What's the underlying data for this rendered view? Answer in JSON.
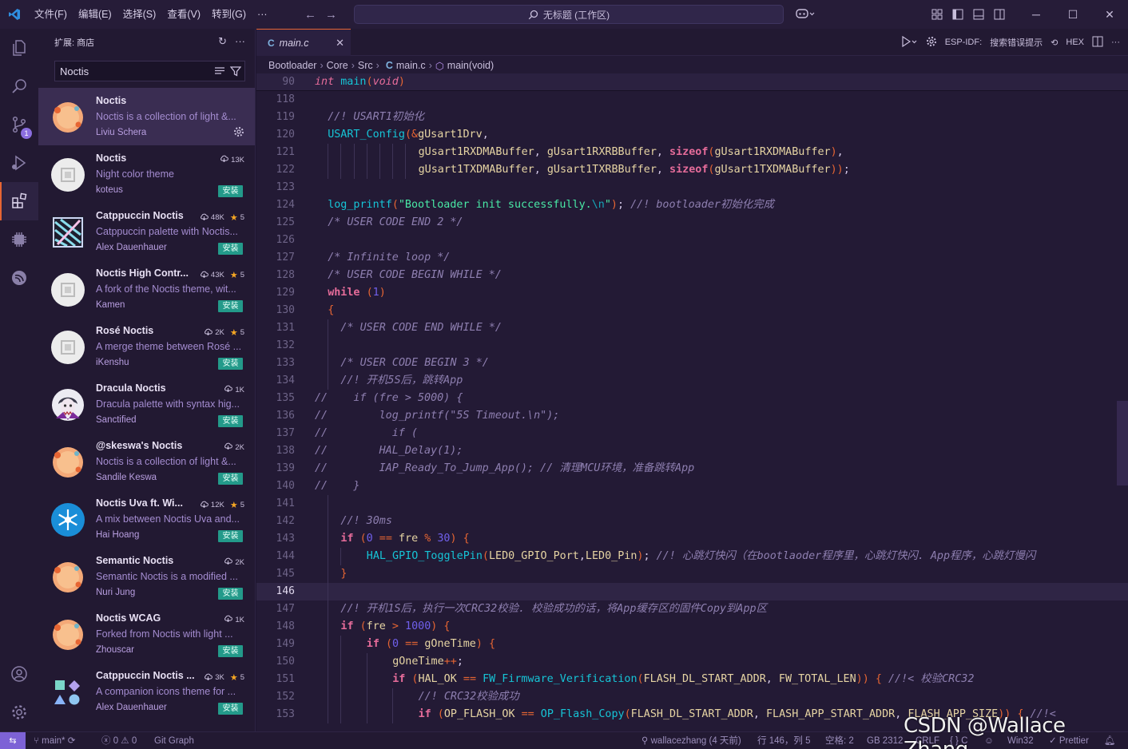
{
  "titlebar": {
    "menus": [
      "文件(F)",
      "编辑(E)",
      "选择(S)",
      "查看(V)",
      "转到(G)",
      "···"
    ],
    "search_text": "无标题 (工作区)"
  },
  "activity": {
    "badge": "1",
    "items": [
      "explorer-icon",
      "search-icon",
      "source-control-icon",
      "run-debug-icon",
      "extensions-icon",
      "chip-icon",
      "espressif-icon"
    ],
    "bottom": [
      "account-icon",
      "settings-gear-icon"
    ]
  },
  "sidebar": {
    "title": "扩展: 商店",
    "search_value": "Noctis",
    "install_label": "安装",
    "extensions": [
      {
        "name": "Noctis",
        "desc": "Noctis is a collection of light &...",
        "publisher": "Liviu Schera",
        "downloads": "",
        "rating": "",
        "installed": true,
        "icon": "noctis-peach"
      },
      {
        "name": "Noctis",
        "desc": "Night color theme",
        "publisher": "koteus",
        "downloads": "13K",
        "rating": "",
        "installed": false,
        "icon": "placeholder"
      },
      {
        "name": "Catppuccin Noctis",
        "desc": "Catppuccin palette with Noctis...",
        "publisher": "Alex Dauenhauer",
        "downloads": "48K",
        "rating": "5",
        "installed": false,
        "icon": "catppuccin"
      },
      {
        "name": "Noctis High Contr...",
        "desc": "A fork of the Noctis theme, wit...",
        "publisher": "Kamen",
        "downloads": "43K",
        "rating": "5",
        "installed": false,
        "icon": "placeholder"
      },
      {
        "name": "Rosé Noctis",
        "desc": "A merge theme between Rosé ...",
        "publisher": "iKenshu",
        "downloads": "2K",
        "rating": "5",
        "installed": false,
        "icon": "placeholder"
      },
      {
        "name": "Dracula Noctis",
        "desc": "Dracula palette with syntax hig...",
        "publisher": "Sanctified",
        "downloads": "1K",
        "rating": "",
        "installed": false,
        "icon": "dracula"
      },
      {
        "name": "@skeswa's Noctis",
        "desc": "Noctis is a collection of light &...",
        "publisher": "Sandile Keswa",
        "downloads": "2K",
        "rating": "",
        "installed": false,
        "icon": "noctis-peach"
      },
      {
        "name": "Noctis Uva ft. Wi...",
        "desc": "A mix between Noctis Uva and...",
        "publisher": "Hai Hoang",
        "downloads": "12K",
        "rating": "5",
        "installed": false,
        "icon": "snowflake"
      },
      {
        "name": "Semantic Noctis",
        "desc": "Semantic Noctis is a modified ...",
        "publisher": "Nuri Jung",
        "downloads": "2K",
        "rating": "",
        "installed": false,
        "icon": "noctis-peach"
      },
      {
        "name": "Noctis WCAG",
        "desc": "Forked from Noctis with light ...",
        "publisher": "Zhouscar",
        "downloads": "1K",
        "rating": "",
        "installed": false,
        "icon": "noctis-peach"
      },
      {
        "name": "Catppuccin Noctis ...",
        "desc": "A companion icons theme for ...",
        "publisher": "Alex Dauenhauer",
        "downloads": "3K",
        "rating": "5",
        "installed": false,
        "icon": "shapes"
      }
    ]
  },
  "editor": {
    "tab_label": "main.c",
    "tab_lang": "C",
    "esp_idf_label": "ESP-IDF:",
    "esp_idf_action": "搜索错误提示",
    "hex_label": "HEX",
    "breadcrumb": [
      "Bootloader",
      "Core",
      "Src",
      "main.c",
      "main(void)"
    ],
    "sticky_line": {
      "num": "90",
      "code": "int main(void)"
    },
    "current_line": "146",
    "lines": [
      {
        "num": "118",
        "code": ""
      },
      {
        "num": "119",
        "code": "//! USART1初始化"
      },
      {
        "num": "120",
        "code": "USART_Config(&gUsart1Drv,"
      },
      {
        "num": "121",
        "code": "gUsart1RXDMABuffer, gUsart1RXRBBuffer, sizeof(gUsart1RXDMABuffer),"
      },
      {
        "num": "122",
        "code": "gUsart1TXDMABuffer, gUsart1TXRBBuffer, sizeof(gUsart1TXDMABuffer));"
      },
      {
        "num": "123",
        "code": ""
      },
      {
        "num": "124",
        "code": "log_printf(\"Bootloader init successfully.\\n\"); //! bootloader初始化完成"
      },
      {
        "num": "125",
        "code": "/* USER CODE END 2 */"
      },
      {
        "num": "126",
        "code": ""
      },
      {
        "num": "127",
        "code": "/* Infinite loop */"
      },
      {
        "num": "128",
        "code": "/* USER CODE BEGIN WHILE */"
      },
      {
        "num": "129",
        "code": "while (1)"
      },
      {
        "num": "130",
        "code": "{"
      },
      {
        "num": "131",
        "code": "/* USER CODE END WHILE */"
      },
      {
        "num": "132",
        "code": ""
      },
      {
        "num": "133",
        "code": "/* USER CODE BEGIN 3 */"
      },
      {
        "num": "134",
        "code": "//! 开机5S后，跳转App"
      },
      {
        "num": "135",
        "code": "//    if (fre > 5000) {"
      },
      {
        "num": "136",
        "code": "//        log_printf(\"5S Timeout.\\n\");"
      },
      {
        "num": "137",
        "code": "//          if ("
      },
      {
        "num": "138",
        "code": "//        HAL_Delay(1);"
      },
      {
        "num": "139",
        "code": "//        IAP_Ready_To_Jump_App(); // 清理MCU环境，准备跳转App"
      },
      {
        "num": "140",
        "code": "//    }"
      },
      {
        "num": "141",
        "code": ""
      },
      {
        "num": "142",
        "code": "//! 30ms"
      },
      {
        "num": "143",
        "code": "if (0 == fre % 30) {"
      },
      {
        "num": "144",
        "code": "HAL_GPIO_TogglePin(LED0_GPIO_Port,LED0_Pin); //! 心跳灯快闪（在bootlaoder程序里，心跳灯快闪. App程序，心跳灯慢闪"
      },
      {
        "num": "145",
        "code": "}"
      },
      {
        "num": "146",
        "code": ""
      },
      {
        "num": "147",
        "code": "//! 开机1S后，执行一次CRC32校验. 校验成功的话，将App缓存区的固件Copy到App区"
      },
      {
        "num": "148",
        "code": "if (fre > 1000) {"
      },
      {
        "num": "149",
        "code": "if (0 == gOneTime) {"
      },
      {
        "num": "150",
        "code": "gOneTime++;"
      },
      {
        "num": "151",
        "code": "if (HAL_OK == FW_Firmware_Verification(FLASH_DL_START_ADDR, FW_TOTAL_LEN)) { //!< 校验CRC32"
      },
      {
        "num": "152",
        "code": "//! CRC32校验成功"
      },
      {
        "num": "153",
        "code": "if (OP_FLASH_OK == OP_Flash_Copy(FLASH_DL_START_ADDR, FLASH_APP_START_ADDR, FLASH_APP_SIZE)) { //!<"
      }
    ]
  },
  "statusbar": {
    "branch": "main*",
    "errors": "0",
    "warnings": "0",
    "git_graph": "Git Graph",
    "blame": "wallacezhang (4 天前)",
    "position": "行 146，列 5",
    "spaces": "空格: 2",
    "encoding": "GB 2312",
    "eol": "CRLF",
    "lang": "C",
    "platform": "Win32",
    "prettier": "Prettier"
  },
  "watermark": "CSDN @Wallace Zhang",
  "colors": {
    "accent": "#e66533",
    "install": "#239a8a",
    "badge": "#8b6ee0",
    "keyword": "#e66c9a",
    "function": "#16c4d6",
    "string": "#49e9a6",
    "comment": "#8e7fb0"
  }
}
